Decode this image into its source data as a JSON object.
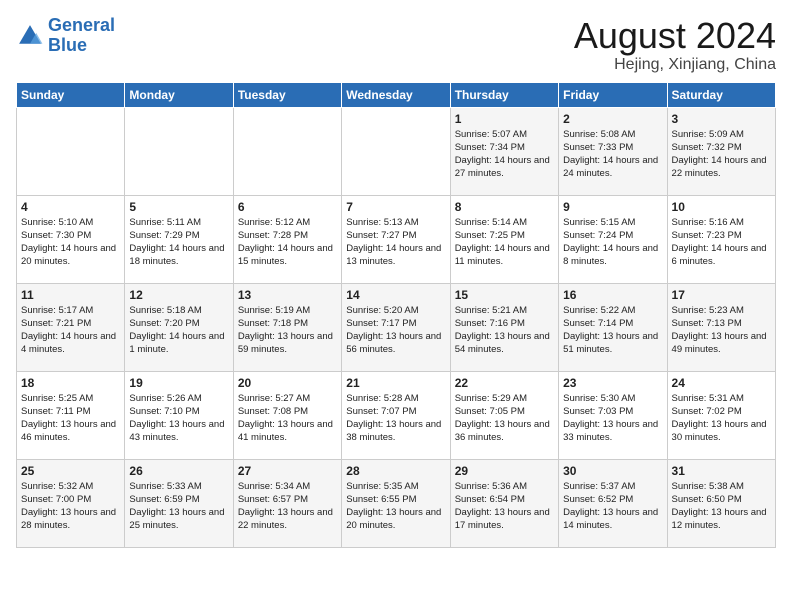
{
  "logo": {
    "line1": "General",
    "line2": "Blue"
  },
  "title": "August 2024",
  "location": "Hejing, Xinjiang, China",
  "weekdays": [
    "Sunday",
    "Monday",
    "Tuesday",
    "Wednesday",
    "Thursday",
    "Friday",
    "Saturday"
  ],
  "weeks": [
    [
      {
        "day": "",
        "sunrise": "",
        "sunset": "",
        "daylight": ""
      },
      {
        "day": "",
        "sunrise": "",
        "sunset": "",
        "daylight": ""
      },
      {
        "day": "",
        "sunrise": "",
        "sunset": "",
        "daylight": ""
      },
      {
        "day": "",
        "sunrise": "",
        "sunset": "",
        "daylight": ""
      },
      {
        "day": "1",
        "sunrise": "Sunrise: 5:07 AM",
        "sunset": "Sunset: 7:34 PM",
        "daylight": "Daylight: 14 hours and 27 minutes."
      },
      {
        "day": "2",
        "sunrise": "Sunrise: 5:08 AM",
        "sunset": "Sunset: 7:33 PM",
        "daylight": "Daylight: 14 hours and 24 minutes."
      },
      {
        "day": "3",
        "sunrise": "Sunrise: 5:09 AM",
        "sunset": "Sunset: 7:32 PM",
        "daylight": "Daylight: 14 hours and 22 minutes."
      }
    ],
    [
      {
        "day": "4",
        "sunrise": "Sunrise: 5:10 AM",
        "sunset": "Sunset: 7:30 PM",
        "daylight": "Daylight: 14 hours and 20 minutes."
      },
      {
        "day": "5",
        "sunrise": "Sunrise: 5:11 AM",
        "sunset": "Sunset: 7:29 PM",
        "daylight": "Daylight: 14 hours and 18 minutes."
      },
      {
        "day": "6",
        "sunrise": "Sunrise: 5:12 AM",
        "sunset": "Sunset: 7:28 PM",
        "daylight": "Daylight: 14 hours and 15 minutes."
      },
      {
        "day": "7",
        "sunrise": "Sunrise: 5:13 AM",
        "sunset": "Sunset: 7:27 PM",
        "daylight": "Daylight: 14 hours and 13 minutes."
      },
      {
        "day": "8",
        "sunrise": "Sunrise: 5:14 AM",
        "sunset": "Sunset: 7:25 PM",
        "daylight": "Daylight: 14 hours and 11 minutes."
      },
      {
        "day": "9",
        "sunrise": "Sunrise: 5:15 AM",
        "sunset": "Sunset: 7:24 PM",
        "daylight": "Daylight: 14 hours and 8 minutes."
      },
      {
        "day": "10",
        "sunrise": "Sunrise: 5:16 AM",
        "sunset": "Sunset: 7:23 PM",
        "daylight": "Daylight: 14 hours and 6 minutes."
      }
    ],
    [
      {
        "day": "11",
        "sunrise": "Sunrise: 5:17 AM",
        "sunset": "Sunset: 7:21 PM",
        "daylight": "Daylight: 14 hours and 4 minutes."
      },
      {
        "day": "12",
        "sunrise": "Sunrise: 5:18 AM",
        "sunset": "Sunset: 7:20 PM",
        "daylight": "Daylight: 14 hours and 1 minute."
      },
      {
        "day": "13",
        "sunrise": "Sunrise: 5:19 AM",
        "sunset": "Sunset: 7:18 PM",
        "daylight": "Daylight: 13 hours and 59 minutes."
      },
      {
        "day": "14",
        "sunrise": "Sunrise: 5:20 AM",
        "sunset": "Sunset: 7:17 PM",
        "daylight": "Daylight: 13 hours and 56 minutes."
      },
      {
        "day": "15",
        "sunrise": "Sunrise: 5:21 AM",
        "sunset": "Sunset: 7:16 PM",
        "daylight": "Daylight: 13 hours and 54 minutes."
      },
      {
        "day": "16",
        "sunrise": "Sunrise: 5:22 AM",
        "sunset": "Sunset: 7:14 PM",
        "daylight": "Daylight: 13 hours and 51 minutes."
      },
      {
        "day": "17",
        "sunrise": "Sunrise: 5:23 AM",
        "sunset": "Sunset: 7:13 PM",
        "daylight": "Daylight: 13 hours and 49 minutes."
      }
    ],
    [
      {
        "day": "18",
        "sunrise": "Sunrise: 5:25 AM",
        "sunset": "Sunset: 7:11 PM",
        "daylight": "Daylight: 13 hours and 46 minutes."
      },
      {
        "day": "19",
        "sunrise": "Sunrise: 5:26 AM",
        "sunset": "Sunset: 7:10 PM",
        "daylight": "Daylight: 13 hours and 43 minutes."
      },
      {
        "day": "20",
        "sunrise": "Sunrise: 5:27 AM",
        "sunset": "Sunset: 7:08 PM",
        "daylight": "Daylight: 13 hours and 41 minutes."
      },
      {
        "day": "21",
        "sunrise": "Sunrise: 5:28 AM",
        "sunset": "Sunset: 7:07 PM",
        "daylight": "Daylight: 13 hours and 38 minutes."
      },
      {
        "day": "22",
        "sunrise": "Sunrise: 5:29 AM",
        "sunset": "Sunset: 7:05 PM",
        "daylight": "Daylight: 13 hours and 36 minutes."
      },
      {
        "day": "23",
        "sunrise": "Sunrise: 5:30 AM",
        "sunset": "Sunset: 7:03 PM",
        "daylight": "Daylight: 13 hours and 33 minutes."
      },
      {
        "day": "24",
        "sunrise": "Sunrise: 5:31 AM",
        "sunset": "Sunset: 7:02 PM",
        "daylight": "Daylight: 13 hours and 30 minutes."
      }
    ],
    [
      {
        "day": "25",
        "sunrise": "Sunrise: 5:32 AM",
        "sunset": "Sunset: 7:00 PM",
        "daylight": "Daylight: 13 hours and 28 minutes."
      },
      {
        "day": "26",
        "sunrise": "Sunrise: 5:33 AM",
        "sunset": "Sunset: 6:59 PM",
        "daylight": "Daylight: 13 hours and 25 minutes."
      },
      {
        "day": "27",
        "sunrise": "Sunrise: 5:34 AM",
        "sunset": "Sunset: 6:57 PM",
        "daylight": "Daylight: 13 hours and 22 minutes."
      },
      {
        "day": "28",
        "sunrise": "Sunrise: 5:35 AM",
        "sunset": "Sunset: 6:55 PM",
        "daylight": "Daylight: 13 hours and 20 minutes."
      },
      {
        "day": "29",
        "sunrise": "Sunrise: 5:36 AM",
        "sunset": "Sunset: 6:54 PM",
        "daylight": "Daylight: 13 hours and 17 minutes."
      },
      {
        "day": "30",
        "sunrise": "Sunrise: 5:37 AM",
        "sunset": "Sunset: 6:52 PM",
        "daylight": "Daylight: 13 hours and 14 minutes."
      },
      {
        "day": "31",
        "sunrise": "Sunrise: 5:38 AM",
        "sunset": "Sunset: 6:50 PM",
        "daylight": "Daylight: 13 hours and 12 minutes."
      }
    ]
  ]
}
